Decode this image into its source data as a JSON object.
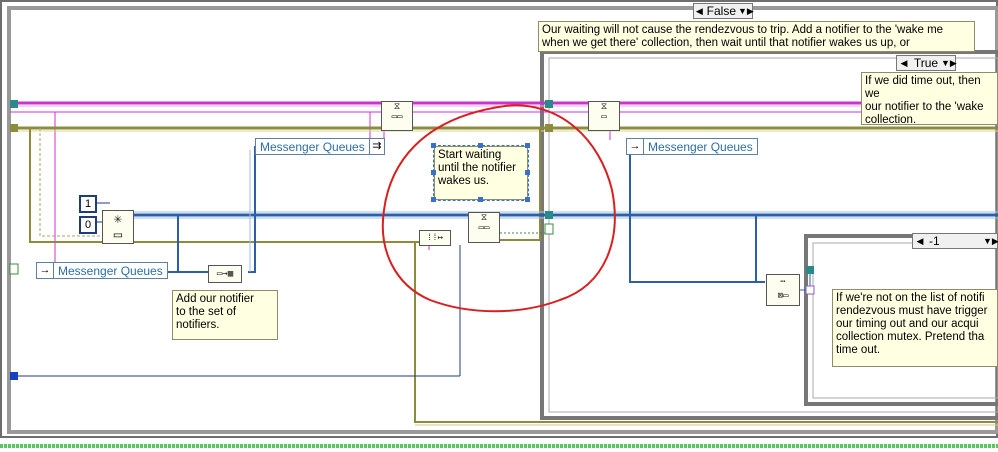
{
  "case_selectors": {
    "outer": {
      "value": "False",
      "left_arrow": "◀",
      "right_arrow": "▼▶"
    },
    "inner": {
      "value": "True",
      "left_arrow": "◀",
      "right_arrow": "▼▶"
    },
    "deep": {
      "value": "-1",
      "left_arrow": "◀",
      "right_arrow": "▼▶"
    }
  },
  "comments": {
    "waiting": "Our waiting will not cause the rendezvous to trip.  Add a notifier to the 'wake me when we get there' collection, then wait until that notifier wakes us up, or",
    "timeout": "If we did time out, then we\nour notifier to the 'wake\ncollection.",
    "start": "Start waiting\nuntil the notifier\nwakes us.",
    "add": "Add our notifier\nto the set of\nnotifiers.",
    "not_on_list": "If we're not on the list of notifi\nrendezvous must have trigger\nour timing out and our acqui\ncollection mutex.  Pretend tha\ntime out."
  },
  "tunnels": {
    "mq_left": "Messenger Queues",
    "mq_mid": "Messenger Queues",
    "mq_right": "Messenger Queues"
  },
  "constants": {
    "one": "1",
    "zero": "0"
  },
  "icons": {
    "arrow": "→",
    "wait_node": "wait-on-notification-icon",
    "build_array": "build-array-icon",
    "insert": "insert-into-array-icon",
    "search": "search-array-icon"
  },
  "colors": {
    "pink_wire": "#cc33cc",
    "blue_wire": "#2c5fa8",
    "yellow_wire": "#8c8c3c",
    "frame": "#6e6e6e",
    "highlight": "#d92020",
    "status_bar": "#5cc75c"
  }
}
